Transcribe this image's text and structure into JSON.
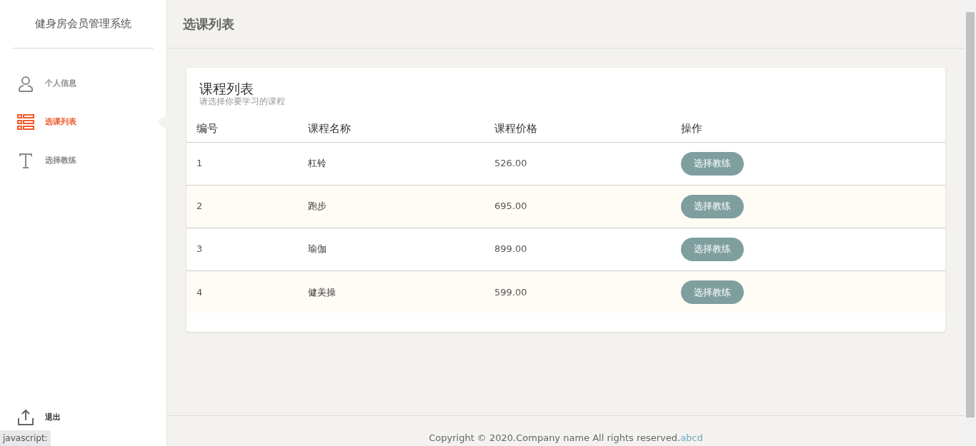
{
  "sidebar": {
    "brand": "健身房会员管理系统",
    "items": [
      {
        "kind": "user",
        "label": "个人信息",
        "selected": false
      },
      {
        "kind": "list",
        "label": "选课列表",
        "selected": true
      },
      {
        "kind": "text",
        "label": "选择教练",
        "selected": false
      }
    ],
    "logout": "退出"
  },
  "header": {
    "title": "选课列表"
  },
  "card": {
    "title": "课程列表",
    "subtitle": "请选择你要学习的课程",
    "columns": [
      "编号",
      "课程名称",
      "课程价格",
      "操作"
    ],
    "rows": [
      {
        "id": "1",
        "name": "杠铃",
        "price": "526.00",
        "action": "选择教练"
      },
      {
        "id": "2",
        "name": "跑步",
        "price": "695.00",
        "action": "选择教练"
      },
      {
        "id": "3",
        "name": "瑜伽",
        "price": "899.00",
        "action": "选择教练"
      },
      {
        "id": "4",
        "name": "健美操",
        "price": "599.00",
        "action": "选择教练"
      }
    ]
  },
  "footer": {
    "text": "Copyright © 2020.Company name All rights reserved.",
    "link": "abcd"
  },
  "status_url": "javascript:"
}
